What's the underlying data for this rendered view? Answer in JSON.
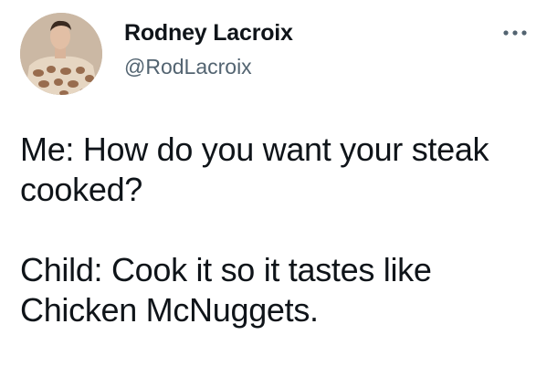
{
  "author": {
    "display_name": "Rodney Lacroix",
    "handle": "@RodLacroix",
    "avatar_icon": "profile-photo"
  },
  "menu": {
    "icon": "more-dots-icon"
  },
  "tweet": {
    "line1": "Me: How do you want your steak cooked?",
    "line2": "Child: Cook it so it tastes like Chicken McNuggets."
  },
  "colors": {
    "text": "#0f1419",
    "secondary": "#536471",
    "background": "#ffffff"
  }
}
